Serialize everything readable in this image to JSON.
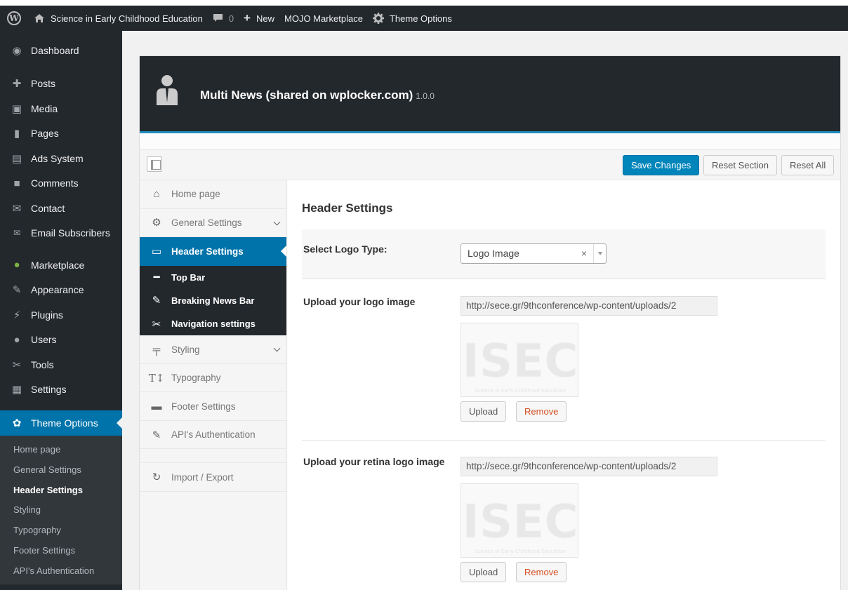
{
  "admin_bar": {
    "site_name": "Science in Early Childhood Education",
    "comments_count": "0",
    "new_label": "New",
    "mojo_label": "MOJO Marketplace",
    "theme_options_label": "Theme Options"
  },
  "sidebar": {
    "items": [
      {
        "label": "Dashboard",
        "icon": "dashboard-icon"
      },
      {
        "label": "Posts",
        "icon": "pin-icon"
      },
      {
        "label": "Media",
        "icon": "media-icon"
      },
      {
        "label": "Pages",
        "icon": "pages-icon"
      },
      {
        "label": "Ads System",
        "icon": "ads-icon"
      },
      {
        "label": "Comments",
        "icon": "comment-icon"
      },
      {
        "label": "Contact",
        "icon": "mail-icon"
      },
      {
        "label": "Email Subscribers",
        "icon": "envelope-icon"
      },
      {
        "label": "Marketplace",
        "icon": "marketplace-icon"
      },
      {
        "label": "Appearance",
        "icon": "brush-icon"
      },
      {
        "label": "Plugins",
        "icon": "plug-icon"
      },
      {
        "label": "Users",
        "icon": "user-icon"
      },
      {
        "label": "Tools",
        "icon": "wrench-icon"
      },
      {
        "label": "Settings",
        "icon": "settings-icon"
      }
    ],
    "current": {
      "label": "Theme Options",
      "icon": "gear-icon"
    },
    "submenu": [
      "Home page",
      "General Settings",
      "Header Settings",
      "Styling",
      "Typography",
      "Footer Settings",
      "API's Authentication"
    ],
    "submenu_active": "Header Settings"
  },
  "panel": {
    "title": "Multi News (shared on wplocker.com)",
    "version": "1.0.0"
  },
  "toolbar": {
    "save_label": "Save Changes",
    "reset_section_label": "Reset Section",
    "reset_all_label": "Reset All"
  },
  "options_nav": {
    "home": "Home page",
    "general": "General Settings",
    "header": "Header Settings",
    "top_bar": "Top Bar",
    "breaking_news": "Breaking News Bar",
    "navigation": "Navigation settings",
    "styling": "Styling",
    "typography": "Typography",
    "footer": "Footer Settings",
    "api": "API's Authentication",
    "import_export": "Import / Export"
  },
  "content": {
    "section_title": "Header Settings",
    "logo_type_label": "Select Logo Type:",
    "logo_type_value": "Logo Image",
    "logo_upload_label": "Upload your logo image",
    "logo_url": "http://sece.gr/9thconference/wp-content/uploads/2",
    "retina_label": "Upload your retina logo image",
    "retina_url": "http://sece.gr/9thconference/wp-content/uploads/2",
    "upload_label": "Upload",
    "remove_label": "Remove",
    "logo_text": "ISEC",
    "logo_subtext": "Science in Early Childhood Education"
  },
  "colors": {
    "admin_dark": "#23282d",
    "accent_blue": "#0073aa",
    "remove_red": "#d54e21"
  }
}
